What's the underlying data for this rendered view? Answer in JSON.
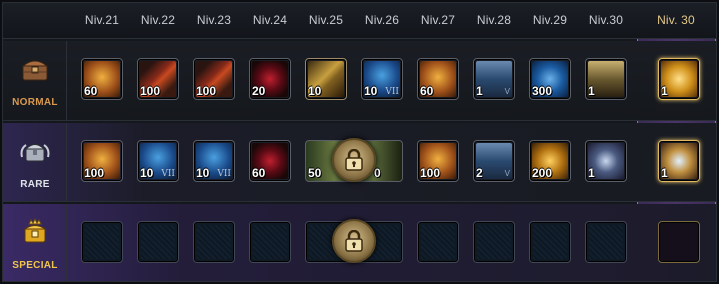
{
  "columns": [
    "Niv.21",
    "Niv.22",
    "Niv.23",
    "Niv.24",
    "Niv.25",
    "Niv.26",
    "Niv.27",
    "Niv.28",
    "Niv.29",
    "Niv.30"
  ],
  "final_column": "Niv. 30",
  "rows": {
    "normal": {
      "label": "NORMAL",
      "icon": "brown-chest-icon",
      "items": [
        {
          "qty": "60",
          "icon": "gold-coin-icon"
        },
        {
          "qty": "100",
          "icon": "red-feather-icon"
        },
        {
          "qty": "100",
          "icon": "red-feather-icon"
        },
        {
          "qty": "20",
          "icon": "red-gem-icon"
        },
        {
          "qty": "10",
          "icon": "gold-ingot-icon"
        },
        {
          "qty": "10",
          "roman": "VII",
          "icon": "blue-shield-icon"
        },
        {
          "qty": "60",
          "icon": "gold-coin-icon"
        },
        {
          "qty": "1",
          "chevron": "V",
          "icon": "blue-chest-icon"
        },
        {
          "qty": "300",
          "icon": "blue-crystal-icon"
        },
        {
          "qty": "1",
          "icon": "gold-chest-icon"
        }
      ],
      "final": {
        "qty": "1",
        "icon": "gold-treasure-chest-icon"
      }
    },
    "rare": {
      "label": "RARE",
      "icon": "silver-chest-icon",
      "items": [
        {
          "qty": "100",
          "icon": "gold-coin-icon"
        },
        {
          "qty": "10",
          "roman": "VII",
          "icon": "blue-shield-icon"
        },
        {
          "qty": "10",
          "roman": "VII",
          "icon": "blue-shield-icon"
        },
        {
          "qty": "60",
          "icon": "red-gem-icon"
        },
        {
          "qty": "50",
          "icon": "dragon-icon"
        },
        {
          "qty": "0",
          "icon": "dragon-icon"
        },
        {
          "qty": "100",
          "icon": "gold-coin-icon"
        },
        {
          "qty": "2",
          "chevron": "V",
          "icon": "blue-chest-icon"
        },
        {
          "qty": "200",
          "icon": "gold-ore-icon"
        },
        {
          "qty": "1",
          "icon": "crystal-chest-icon"
        }
      ],
      "final": {
        "qty": "1",
        "icon": "crystal-chest-icon"
      }
    },
    "special": {
      "label": "SPECIAL",
      "icon": "crowned-chest-icon",
      "locked": true
    }
  },
  "colors": {
    "final_column_bg": "#4a3468",
    "final_column_border": "#8a6fc0",
    "normal_label": "#d99a4e",
    "special_label": "#f0c64a"
  }
}
